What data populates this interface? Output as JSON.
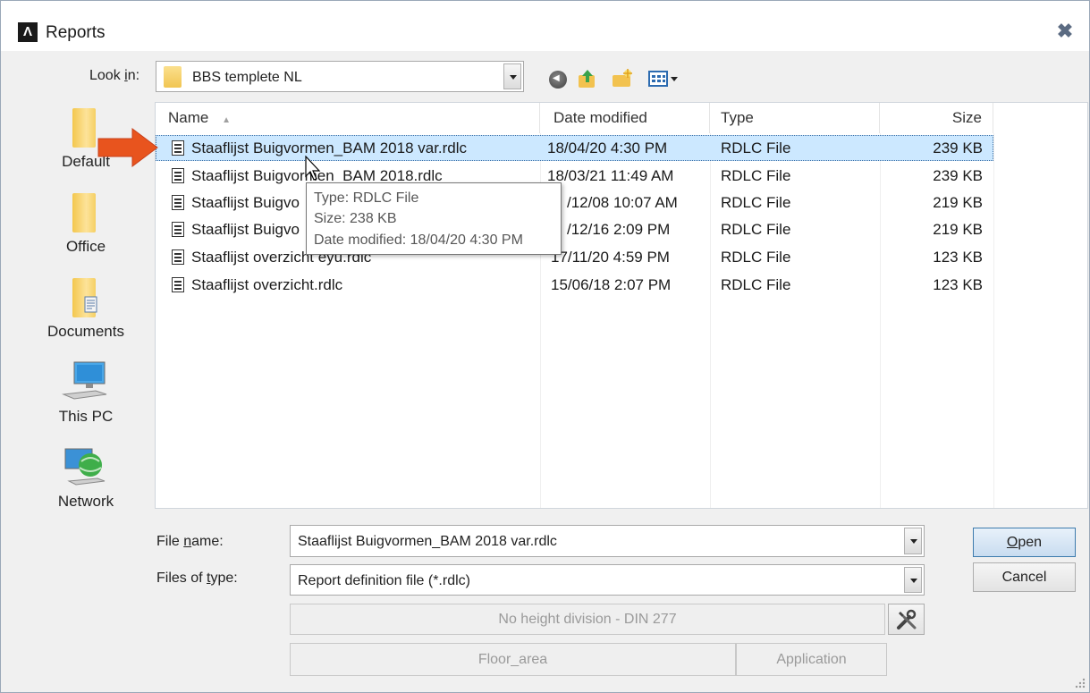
{
  "window": {
    "title": "Reports",
    "close_icon": "close-icon"
  },
  "look_in": {
    "label_pre": "Look ",
    "label_key": "i",
    "label_post": "n:",
    "value": "BBS templete NL"
  },
  "places": [
    {
      "label": "Default"
    },
    {
      "label": "Office"
    },
    {
      "label": "Documents"
    },
    {
      "label": "This PC"
    },
    {
      "label": "Network"
    }
  ],
  "columns": {
    "name": "Name",
    "date": "Date modified",
    "type": "Type",
    "size": "Size"
  },
  "files": [
    {
      "name": "Staaflijst Buigvormen_BAM 2018 var.rdlc",
      "date": "18/04/20 4:30 PM",
      "type": "RDLC File",
      "size": "239 KB"
    },
    {
      "name": "Staaflijst Buigvormen_BAM 2018.rdlc",
      "date": "18/03/21 11:49 AM",
      "type": "RDLC File",
      "size": "239 KB"
    },
    {
      "name": "Staaflijst Buigvo",
      "date": "/12/08 10:07 AM",
      "type": "RDLC File",
      "size": "219 KB"
    },
    {
      "name": "Staaflijst Buigvo",
      "date": "/12/16 2:09 PM",
      "type": "RDLC File",
      "size": "219 KB"
    },
    {
      "name": "Staaflijst overzicht eyu.rdlc",
      "date": "17/11/20 4:59 PM",
      "type": "RDLC File",
      "size": "123 KB"
    },
    {
      "name": "Staaflijst overzicht.rdlc",
      "date": "15/06/18 2:07 PM",
      "type": "RDLC File",
      "size": "123 KB"
    }
  ],
  "tooltip": {
    "type": "Type: RDLC File",
    "size": "Size: 238 KB",
    "date": "Date modified: 18/04/20 4:30 PM"
  },
  "file_name": {
    "label_pre": "File ",
    "label_key": "n",
    "label_post": "ame:",
    "value": "Staaflijst Buigvormen_BAM 2018 var.rdlc"
  },
  "file_type": {
    "label_pre": "Files of ",
    "label_key": "t",
    "label_post": "ype:",
    "value": "Report definition file (*.rdlc)"
  },
  "buttons": {
    "open_key": "O",
    "open_rest": "pen",
    "cancel": "Cancel",
    "height_division": "No height division - DIN  277",
    "floor_area": "Floor_area",
    "application": "Application"
  },
  "colors": {
    "selection": "#cce8ff",
    "accent_arrow": "#e8541e"
  }
}
